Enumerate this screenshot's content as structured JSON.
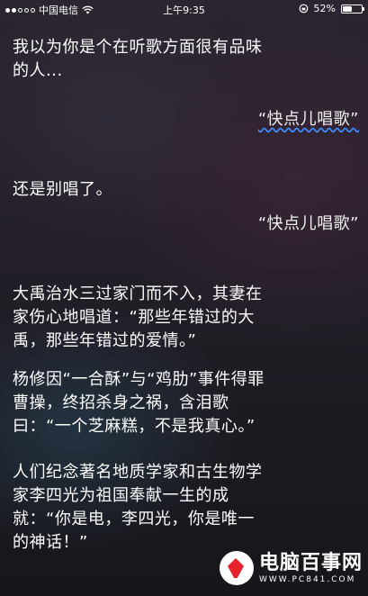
{
  "status_bar": {
    "carrier": "中国电信",
    "time": "上午9:35",
    "battery_percent": "52%",
    "battery_level": 0.52
  },
  "conversation": [
    {
      "speaker": "siri",
      "lines": [
        "我以为你是个在听歌方面很有品味",
        "的人..."
      ]
    },
    {
      "speaker": "user",
      "text": "“快点儿唱歌”"
    },
    {
      "speaker": "siri",
      "lines": [
        "还是别唱了。"
      ]
    },
    {
      "speaker": "user",
      "text": "“快点儿唱歌”"
    },
    {
      "speaker": "siri",
      "lines": [
        "大禹治水三过家门而不入，其妻在",
        "家伤心地唱道：“那些年错过的大",
        "禹，那些年错过的爱情。”"
      ]
    },
    {
      "speaker": "siri",
      "lines": [
        "杨修因“一合酥”与“鸡肋”事件得罪",
        "曹操，终招杀身之祸，含泪歌",
        "曰：“一个芝麻糕，不是我真心。”"
      ]
    },
    {
      "speaker": "siri",
      "lines": [
        "人们纪念著名地质学家和古生物学",
        "家李四光为祖国奉献一生的成",
        "就：“你是电，李四光，你是唯一",
        "的神话！”"
      ]
    }
  ],
  "watermark": {
    "title": "电脑百事网",
    "url": "WWW.PC841.COM"
  }
}
